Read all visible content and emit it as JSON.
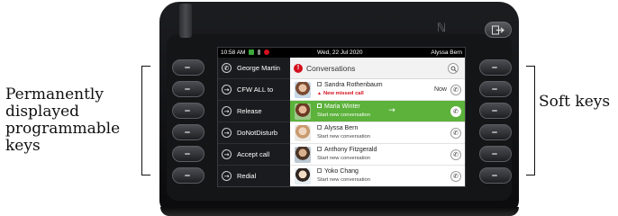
{
  "annotations": {
    "left_label": "Permanently displayed programmable keys",
    "right_label": "Soft keys"
  },
  "status_bar": {
    "time": "10:58 AM",
    "date": "Wed, 22 Jul 2020",
    "user": "Alyssa Bern"
  },
  "programmable_keys": [
    {
      "label": "George Martin",
      "icon": "phone-icon",
      "glyph": "✆"
    },
    {
      "label": "CFW ALL to",
      "icon": "arrow-right-icon",
      "glyph": "→"
    },
    {
      "label": "Release",
      "icon": "arrow-right-icon",
      "glyph": "→"
    },
    {
      "label": "DoNotDisturb",
      "icon": "arrow-right-icon",
      "glyph": "→"
    },
    {
      "label": "Accept call",
      "icon": "arrow-right-icon",
      "glyph": "→"
    },
    {
      "label": "Redial",
      "icon": "arrow-right-icon",
      "glyph": "→"
    }
  ],
  "conversations": {
    "title": "Conversations",
    "alert_glyph": "!",
    "rows": [
      {
        "name": "Sandra Rothenbaum",
        "sub": "New missed call",
        "missed": true,
        "time": "Now",
        "selected": false,
        "avatar_color": "#c98a6a"
      },
      {
        "name": "Maria Winter",
        "sub": "Start new conversation",
        "missed": false,
        "time": "",
        "selected": true,
        "avatar_color": "#b87b5a"
      },
      {
        "name": "Alyssa Bern",
        "sub": "Start new conversation",
        "missed": false,
        "time": "",
        "selected": false,
        "avatar_color": "#d9c2a8"
      },
      {
        "name": "Anthony Fitzgerald",
        "sub": "Start new conversation",
        "missed": false,
        "time": "",
        "selected": false,
        "avatar_color": "#a07a5c"
      },
      {
        "name": "Yoko Chang",
        "sub": "Start new conversation",
        "missed": false,
        "time": "",
        "selected": false,
        "avatar_color": "#d8b89a"
      }
    ]
  },
  "colors": {
    "accent_green": "#5cb23b",
    "alert_red": "#d4101e"
  }
}
